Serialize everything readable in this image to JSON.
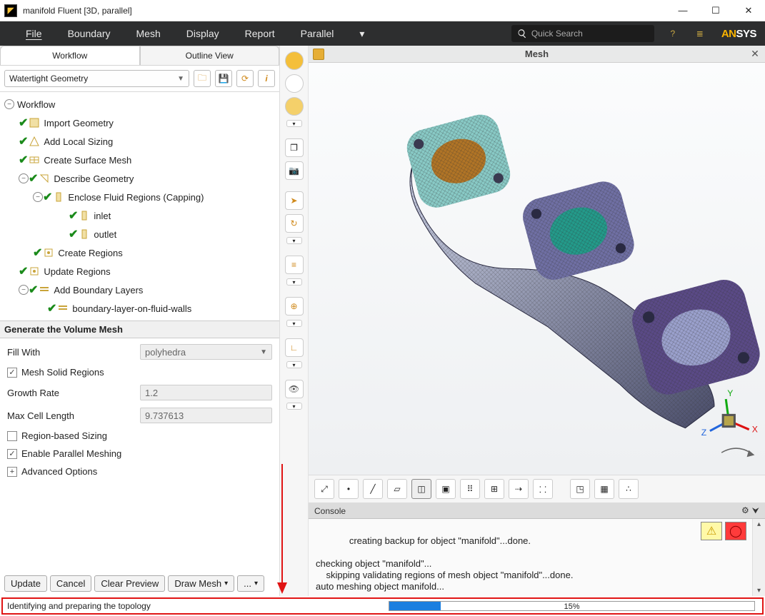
{
  "window": {
    "title": "manifold Fluent  [3D, parallel]"
  },
  "menu": {
    "items": [
      "File",
      "Boundary",
      "Mesh",
      "Display",
      "Report",
      "Parallel"
    ],
    "search_placeholder": "Quick Search",
    "brand_an": "AN",
    "brand_sys": "SYS"
  },
  "leftPanel": {
    "tabs": {
      "workflow": "Workflow",
      "outline": "Outline View"
    },
    "workflow_select": "Watertight Geometry",
    "tree_root": "Workflow",
    "tree": {
      "import_geometry": "Import Geometry",
      "add_local_sizing": "Add Local Sizing",
      "create_surface_mesh": "Create Surface Mesh",
      "describe_geometry": "Describe Geometry",
      "enclose_fluid": "Enclose Fluid Regions (Capping)",
      "inlet": "inlet",
      "outlet": "outlet",
      "create_regions": "Create Regions",
      "update_regions": "Update Regions",
      "add_boundary_layers": "Add Boundary Layers",
      "boundary_layer": "boundary-layer-on-fluid-walls"
    },
    "props_title": "Generate the Volume Mesh",
    "props": {
      "fill_with_label": "Fill With",
      "fill_with_value": "polyhedra",
      "mesh_solid": "Mesh Solid Regions",
      "growth_rate_label": "Growth Rate",
      "growth_rate_value": "1.2",
      "max_cell_label": "Max Cell Length",
      "max_cell_value": "9.737613",
      "region_sizing": "Region-based Sizing",
      "parallel_meshing": "Enable Parallel Meshing",
      "advanced": "Advanced Options"
    },
    "buttons": {
      "update": "Update",
      "cancel": "Cancel",
      "clear": "Clear Preview",
      "draw": "Draw Mesh",
      "more": "..."
    }
  },
  "canvas": {
    "title": "Mesh"
  },
  "console": {
    "title": "Console",
    "text": "creating backup for object \"manifold\"...done.\n\nchecking object \"manifold\"...\n    skipping validating regions of mesh object \"manifold\"...done.\nauto meshing object manifold..."
  },
  "status": {
    "message": "Identifying and preparing the topology",
    "percent": "15%"
  }
}
